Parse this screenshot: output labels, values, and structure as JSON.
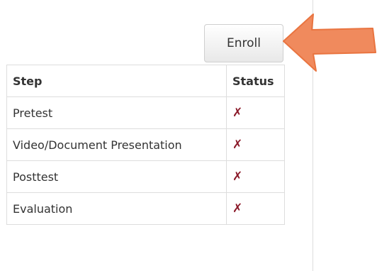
{
  "enroll_button": {
    "label": "Enroll"
  },
  "table": {
    "headers": {
      "step": "Step",
      "status": "Status"
    },
    "rows": [
      {
        "step": "Pretest",
        "status": "✗"
      },
      {
        "step": "Video/Document Presentation",
        "status": "✗"
      },
      {
        "step": "Posttest",
        "status": "✗"
      },
      {
        "step": "Evaluation",
        "status": "✗"
      }
    ]
  },
  "colors": {
    "arrow": "#f08a5d",
    "incomplete_mark": "#8b1a2a"
  },
  "icons": {
    "annotation": "arrow-pointing-left-icon",
    "status": "red-x-icon"
  }
}
